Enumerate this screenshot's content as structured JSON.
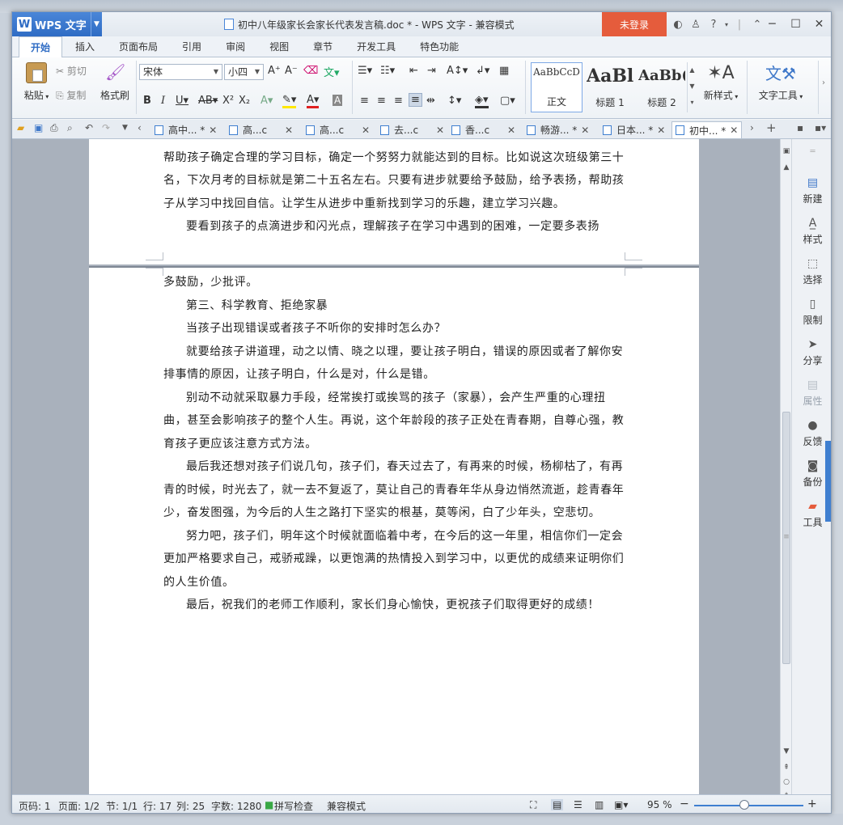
{
  "window": {
    "app_name": "WPS 文字",
    "doc_title": "初中八年级家长会家长代表发言稿.doc * - WPS 文字 - 兼容模式",
    "login_label": "未登录"
  },
  "ribbon_tabs": [
    "开始",
    "插入",
    "页面布局",
    "引用",
    "审阅",
    "视图",
    "章节",
    "开发工具",
    "特色功能"
  ],
  "ribbon": {
    "paste": "粘贴",
    "cut": "剪切",
    "copy": "复制",
    "format_painter": "格式刷",
    "font_name": "宋体",
    "font_size": "小四",
    "styles": [
      {
        "sample": "AaBbCcD",
        "label": "正文"
      },
      {
        "sample": "AaBl",
        "label": "标题 1"
      },
      {
        "sample": "AaBb(",
        "label": "标题 2"
      }
    ],
    "new_style": "新样式",
    "text_tools": "文字工具"
  },
  "doc_tabs": [
    {
      "label": "高中... *",
      "active": false
    },
    {
      "label": "高...c",
      "active": false
    },
    {
      "label": "高...c",
      "active": false
    },
    {
      "label": "去...c",
      "active": false
    },
    {
      "label": "香...c",
      "active": false
    },
    {
      "label": "畅游... *",
      "active": false
    },
    {
      "label": "日本... *",
      "active": false
    },
    {
      "label": "初中... *",
      "active": true
    }
  ],
  "document": {
    "page1_paragraphs": [
      {
        "text": "这些都掌握之后，就要帮孩子分析原因，根据原因调整孩子的学习方式或学习方法。帮助孩子确定合理的学习目标，确定一个努努力就能达到的目标。比如说这次班级第三十名，下次月考的目标就是第二十五名左右。只要有进步就要给予鼓励，给予表扬，帮助孩子从学习中找回自信。让学生从进步中重新找到学习的乐趣，建立学习兴趣。",
        "indent": true
      },
      {
        "text": "要看到孩子的点滴进步和闪光点，理解孩子在学习中遇到的困难，一定要多表扬",
        "indent": true
      }
    ],
    "page2_paragraphs": [
      {
        "text": "多鼓励，少批评。",
        "indent": false
      },
      {
        "text": "第三、科学教育、拒绝家暴",
        "indent": true
      },
      {
        "text": "当孩子出现错误或者孩子不听你的安排时怎么办？",
        "indent": true
      },
      {
        "text": "就要给孩子讲道理，动之以情、晓之以理，要让孩子明白，错误的原因或者了解你安排事情的原因，让孩子明白，什么是对，什么是错。",
        "indent": true
      },
      {
        "text": "别动不动就采取暴力手段，经常挨打或挨骂的孩子（家暴），会产生严重的心理扭曲，甚至会影响孩子的整个人生。再说，这个年龄段的孩子正处在青春期，自尊心强，教育孩子更应该注意方式方法。",
        "indent": true
      },
      {
        "text": "最后我还想对孩子们说几句，孩子们，春天过去了，有再来的时候，杨柳枯了，有再青的时候，时光去了，就一去不复返了，莫让自己的青春年华从身边悄然流逝，趁青春年少，奋发图强，为今后的人生之路打下坚实的根基，莫等闲，白了少年头，空悲切。",
        "indent": true
      },
      {
        "text": "努力吧，孩子们，明年这个时候就面临着中考，在今后的这一年里，相信你们一定会更加严格要求自己，戒骄戒躁，以更饱满的热情投入到学习中，以更优的成绩来证明你们的人生价值。",
        "indent": true
      },
      {
        "text": "最后，祝我们的老师工作顺利，家长们身心愉快，更祝孩子们取得更好的成绩！",
        "indent": true
      }
    ]
  },
  "task_pane": [
    {
      "label": "新建",
      "icon": "new-doc-icon",
      "enabled": true
    },
    {
      "label": "样式",
      "icon": "style-icon",
      "enabled": true
    },
    {
      "label": "选择",
      "icon": "select-icon",
      "enabled": true
    },
    {
      "label": "限制",
      "icon": "restrict-icon",
      "enabled": true
    },
    {
      "label": "分享",
      "icon": "share-icon",
      "enabled": true
    },
    {
      "label": "属性",
      "icon": "properties-icon",
      "enabled": false
    },
    {
      "label": "反馈",
      "icon": "feedback-icon",
      "enabled": true
    },
    {
      "label": "备份",
      "icon": "backup-icon",
      "enabled": true
    },
    {
      "label": "工具",
      "icon": "toolbox-icon",
      "enabled": true
    }
  ],
  "status": {
    "page_code": "页码: 1",
    "page": "页面: 1/2",
    "section": "节: 1/1",
    "row": "行: 17",
    "col": "列: 25",
    "word_count": "字数: 1280",
    "spell_check": "拼写检查",
    "compat_mode": "兼容模式",
    "zoom": "95 %"
  },
  "colors": {
    "accent": "#2f6cc4",
    "login": "#e55c3c"
  }
}
